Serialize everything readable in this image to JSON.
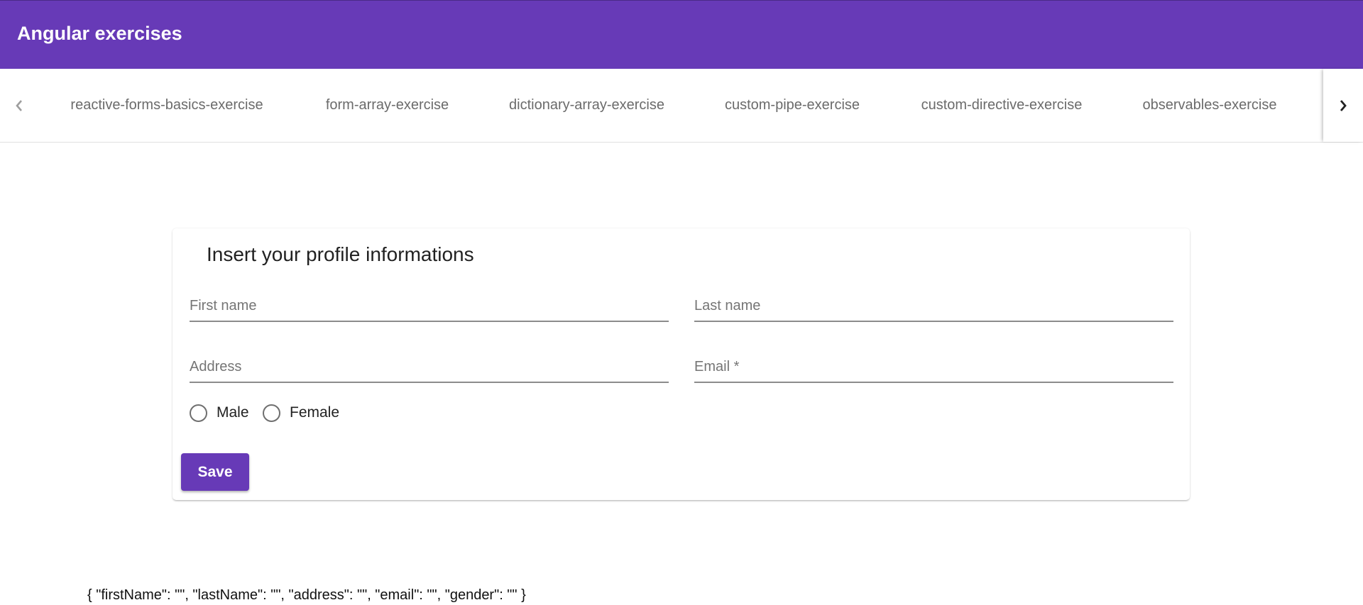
{
  "app": {
    "title": "Angular exercises",
    "accent_color": "#673ab7"
  },
  "tabs": {
    "prev_icon": "chevron-left-icon",
    "next_icon": "chevron-right-icon",
    "items": [
      {
        "label": "reactive-forms-basics-exercise"
      },
      {
        "label": "form-array-exercise"
      },
      {
        "label": "dictionary-array-exercise"
      },
      {
        "label": "custom-pipe-exercise"
      },
      {
        "label": "custom-directive-exercise"
      },
      {
        "label": "observables-exercise"
      }
    ]
  },
  "form": {
    "title": "Insert your profile informations",
    "fields": {
      "first_name": {
        "label": "First name",
        "value": ""
      },
      "last_name": {
        "label": "Last name",
        "value": ""
      },
      "address": {
        "label": "Address",
        "value": ""
      },
      "email": {
        "label": "Email *",
        "value": ""
      }
    },
    "gender": {
      "options": [
        {
          "label": "Male",
          "selected": false
        },
        {
          "label": "Female",
          "selected": false
        }
      ]
    },
    "save_label": "Save"
  },
  "json_output": "{ \"firstName\": \"\", \"lastName\": \"\", \"address\": \"\", \"email\": \"\", \"gender\": \"\" }"
}
